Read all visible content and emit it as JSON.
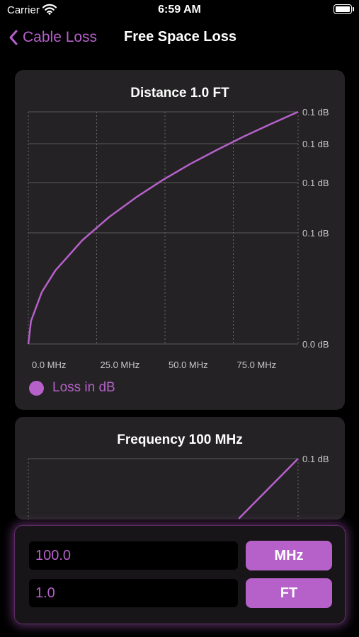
{
  "status_bar": {
    "carrier": "Carrier",
    "time": "6:59 AM"
  },
  "nav": {
    "back_label": "Cable Loss",
    "title": "Free Space Loss"
  },
  "chart_data": [
    {
      "type": "line",
      "title": "Distance 1.0 FT",
      "x_tick_labels": [
        "0.0 MHz",
        "25.0 MHz",
        "50.0 MHz",
        "75.0 MHz"
      ],
      "y_tick_labels": [
        "0.1 dB",
        "0.1 dB",
        "0.1 dB",
        "0.1 dB",
        "0.0 dB"
      ],
      "xlim": [
        0,
        100
      ],
      "series": [
        {
          "name": "Loss in dB",
          "color": "#b561c9",
          "x": [
            0,
            1,
            5,
            10,
            20,
            30,
            40,
            50,
            60,
            70,
            80,
            90,
            100
          ],
          "y": [
            0,
            0.0063,
            0.0142,
            0.0201,
            0.0284,
            0.0348,
            0.0402,
            0.045,
            0.0493,
            0.0532,
            0.0569,
            0.0603,
            0.0636
          ]
        }
      ],
      "legend": "bottom-left",
      "grid": true
    },
    {
      "type": "line",
      "title": "Frequency 100 MHz",
      "y_tick_labels": [
        "0.1 dB"
      ],
      "series": [
        {
          "color": "#b561c9",
          "x": [
            0.78,
            1.0
          ],
          "y": [
            0.78,
            1.0
          ]
        }
      ],
      "grid": true
    }
  ],
  "legend": {
    "label": "Loss in dB",
    "color": "#b561c9"
  },
  "inputs": {
    "frequency_value": "100.0",
    "frequency_unit": "MHz",
    "distance_value": "1.0",
    "distance_unit": "FT"
  },
  "colors": {
    "accent": "#b561c9",
    "card": "#242224",
    "background": "#000000"
  }
}
